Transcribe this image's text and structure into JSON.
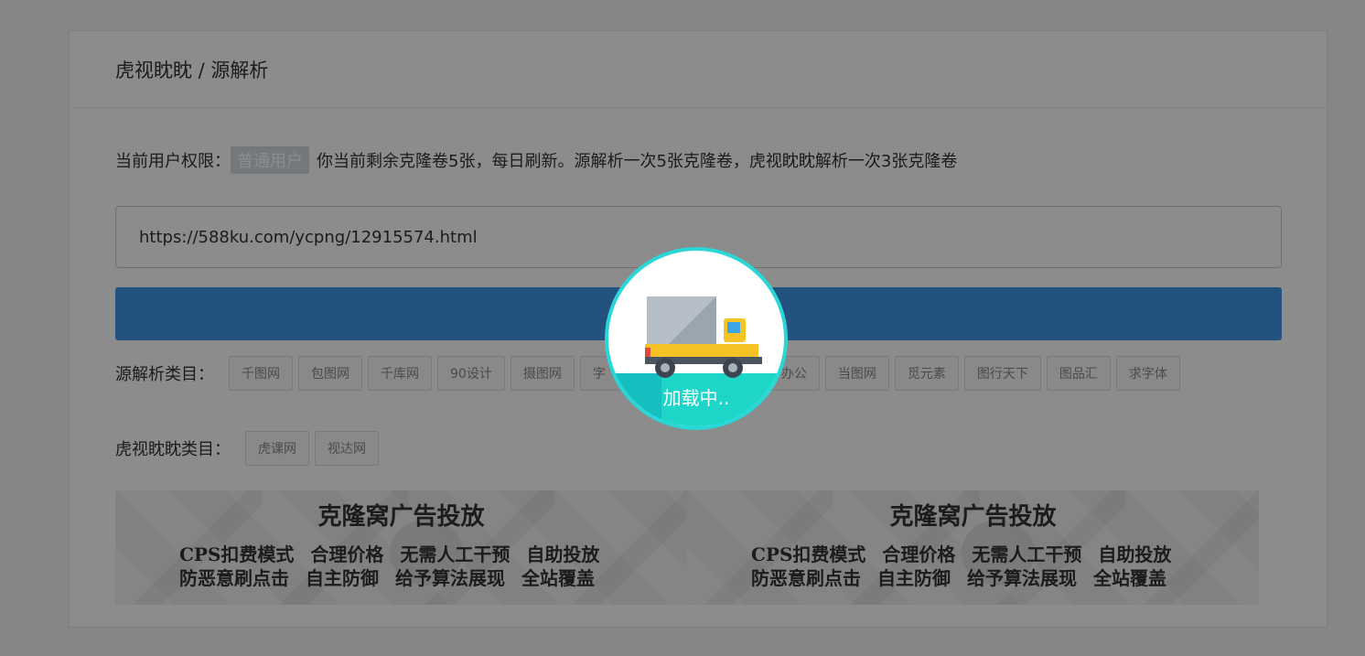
{
  "header": {
    "breadcrumb": "虎视眈眈 / 源解析"
  },
  "permission": {
    "label": "当前用户权限：",
    "badge": "普通用户",
    "message": "你当前剩余克隆卷5张，每日刷新。源解析一次5张克隆卷，虎视眈眈解析一次3张克隆卷"
  },
  "url_input": {
    "value": "https://588ku.com/ycpng/12915574.html"
  },
  "parse_button": {
    "label": "",
    "color": "#3e96e3"
  },
  "source_categories": {
    "label": "源解析类目：",
    "items": [
      "千图网",
      "包图网",
      "千库网",
      "90设计",
      "摄图网",
      "字",
      "",
      "",
      "办公",
      "当图网",
      "觅元素",
      "图行天下",
      "图品汇",
      "求字体"
    ]
  },
  "tiger_categories": {
    "label": "虎视眈眈类目：",
    "items": [
      "虎课网",
      "视达网"
    ]
  },
  "ads": [
    {
      "title": "克隆窝广告投放",
      "line1": [
        "CPS扣费模式",
        "合理价格",
        "无需人工干预",
        "自助投放"
      ],
      "line2": [
        "防恶意刷点击",
        "自主防御",
        "给予算法展现",
        "全站覆盖"
      ]
    },
    {
      "title": "克隆窝广告投放",
      "line1": [
        "CPS扣费模式",
        "合理价格",
        "无需人工干预",
        "自助投放"
      ],
      "line2": [
        "防恶意刷点击",
        "自主防御",
        "给予算法展现",
        "全站覆盖"
      ]
    }
  ],
  "loader": {
    "text": "加载中..",
    "icon": "truck-icon",
    "ring_color": "#2ad6d6"
  }
}
